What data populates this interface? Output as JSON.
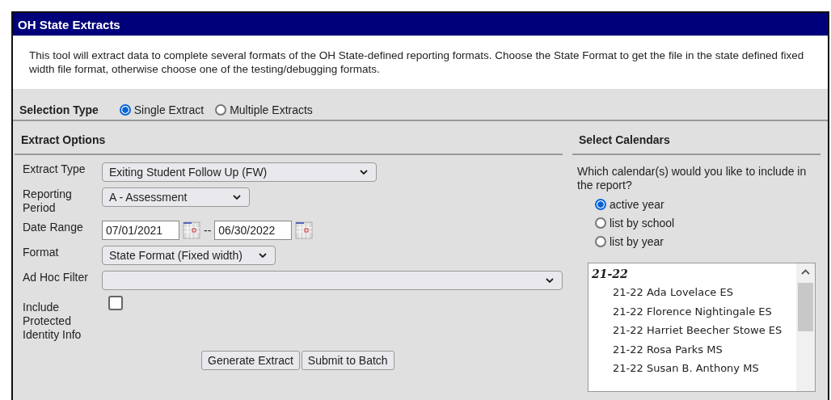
{
  "title": "OH State Extracts",
  "description": "This tool will extract data to complete several formats of the OH State-defined reporting formats. Choose the State Format to get the file in the state defined fixed width file format, otherwise choose one of the testing/debugging formats.",
  "selection_type": {
    "label": "Selection Type",
    "options": [
      {
        "label": "Single Extract",
        "selected": true
      },
      {
        "label": "Multiple Extracts",
        "selected": false
      }
    ]
  },
  "extract_options": {
    "heading": "Extract Options",
    "fields": [
      {
        "kind": "select",
        "label": "Extract Type",
        "value": "Exiting Student Follow Up (FW)"
      },
      {
        "kind": "select",
        "label": "Reporting Period",
        "value": "A - Assessment"
      },
      {
        "kind": "daterange",
        "label": "Date Range",
        "from": "07/01/2021",
        "separator": "--",
        "to": "06/30/2022"
      },
      {
        "kind": "select",
        "label": "Format",
        "value": "State Format (Fixed width)"
      },
      {
        "kind": "select",
        "label": "Ad Hoc Filter"
      },
      {
        "kind": "checkbox",
        "label": "Include Protected Identity Info",
        "checked": false
      }
    ],
    "buttons": [
      "Generate Extract",
      "Submit to Batch"
    ]
  },
  "calendars": {
    "heading": "Select Calendars",
    "question": "Which calendar(s) would you like to include in the report?",
    "options": [
      {
        "label": "active year",
        "selected": true
      },
      {
        "label": "list by school",
        "selected": false
      },
      {
        "label": "list by year",
        "selected": false
      }
    ],
    "groups": [
      {
        "label": "21-22",
        "items": [
          "21-22 Ada Lovelace ES",
          "21-22 Florence Nightingale ES",
          "21-22 Harriet Beecher Stowe ES",
          "21-22 Rosa Parks MS",
          "21-22 Susan B. Anthony MS"
        ]
      }
    ]
  }
}
